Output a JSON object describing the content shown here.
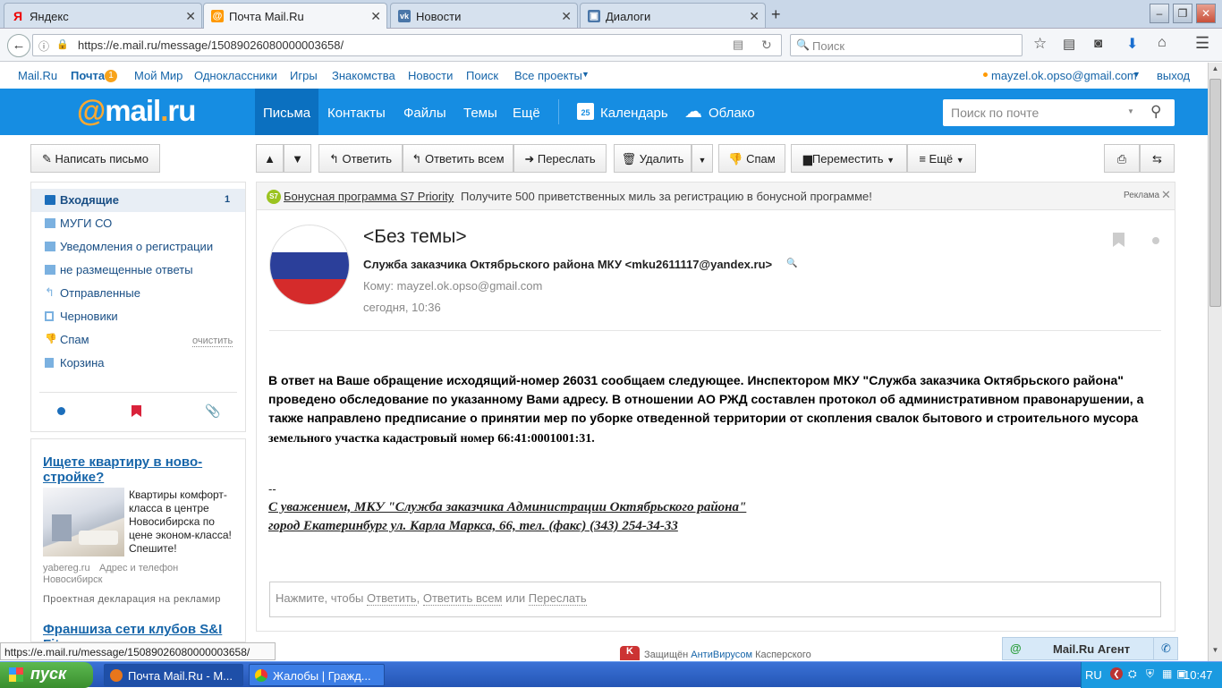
{
  "browser": {
    "tabs": [
      {
        "label": "Яндекс",
        "icon": "yandex-icon"
      },
      {
        "label": "Почта Mail.Ru",
        "icon": "mailru-icon"
      },
      {
        "label": "Новости",
        "icon": "vk-icon"
      },
      {
        "label": "Диалоги",
        "icon": "dialogs-icon"
      }
    ],
    "url": "https://e.mail.ru/message/15089026080000003658/",
    "search_placeholder": "Поиск"
  },
  "topline": {
    "links": [
      "Mail.Ru",
      "Почта",
      "Мой Мир",
      "Одноклассники",
      "Игры",
      "Знакомства",
      "Новости",
      "Поиск",
      "Все проекты"
    ],
    "mail_badge": "1",
    "user": "mayzel.ok.opso@gmail.com",
    "logout": "выход"
  },
  "header": {
    "logo": "@mail.ru",
    "nav": [
      "Письма",
      "Контакты",
      "Файлы",
      "Темы",
      "Ещё"
    ],
    "calendar": "Календарь",
    "calendar_day": "25",
    "cloud": "Облако",
    "search_placeholder": "Поиск по почте"
  },
  "toolbar": {
    "compose": "Написать письмо",
    "reply": "Ответить",
    "reply_all": "Ответить всем",
    "forward": "Переслать",
    "delete": "Удалить",
    "spam": "Спам",
    "move": "Переместить",
    "more": "Ещё"
  },
  "folders": [
    {
      "label": "Входящие",
      "count": "1"
    },
    {
      "label": "МУГИ СО"
    },
    {
      "label": "Уведомления о регистрации"
    },
    {
      "label": "не размещенные ответы"
    },
    {
      "label": "Отправленные"
    },
    {
      "label": "Черновики"
    },
    {
      "label": "Спам",
      "action": "очистить"
    },
    {
      "label": "Корзина"
    }
  ],
  "ads": {
    "title1": "Ищете квартиру в ново-стройке?",
    "text1": "Квартиры комфорт-класса в центре Новосибирска по цене эконом-класса! Спешите!",
    "source1": "yabereg.ru",
    "contact1": "Адрес и телефон",
    "city1": "Новосибирск",
    "decl": "Проектная декларация на рекламир",
    "title2": "Франшиза сети клубов S&I Fitness"
  },
  "banner": {
    "link": "Бонусная программа S7 Priority",
    "text": "Получите 500 приветственных миль за регистрацию в бонусной программе!",
    "label": "Реклама"
  },
  "message": {
    "subject": "<Без темы>",
    "from": "Служба заказчика Октябрьского района МКУ <mku2611117@yandex.ru>",
    "to": "Кому: mayzel.ok.opso@gmail.com",
    "date": "сегодня, 10:36",
    "body_sans": "В ответ на Ваше обращение исходящий-номер 26031 сообщаем следующее. Инспектором МКУ \"Служба заказчика Октябрьского района\" проведено обследование по указанному Вами адресу. В отношении АО РЖД составлен протокол об административном правонарушении, а также направлено предписание о принятии мер по уборке отведенной территории от скопления свалок бытового и строительного мусора",
    "body_serif": " земельного участка кадастровый номер 66:41:0001001:31.",
    "sig_dash": "--",
    "sig1": "С уважением, МКУ \"Служба заказчика Администрации Октябрьского района\"",
    "sig2": "город Екатеринбург ул. Карла Маркса, 66, тел. (факс) (343) 254-34-33",
    "quick_prefix": "Нажмите, чтобы",
    "quick_reply": "Ответить",
    "quick_reply_all": "Ответить всем",
    "quick_or": "или",
    "quick_forward": "Переслать"
  },
  "footer": {
    "antivirus_prefix": "Защищён",
    "antivirus": "АнтиВирусом",
    "antivirus_suffix": "Касперского",
    "agent": "Mail.Ru Агент"
  },
  "status_url": "https://e.mail.ru/message/15089026080000003658/",
  "taskbar": {
    "start": "пуск",
    "items": [
      "Почта Mail.Ru - M...",
      "Жалобы | Гражд..."
    ],
    "lang": "RU",
    "clock": "10:47"
  }
}
